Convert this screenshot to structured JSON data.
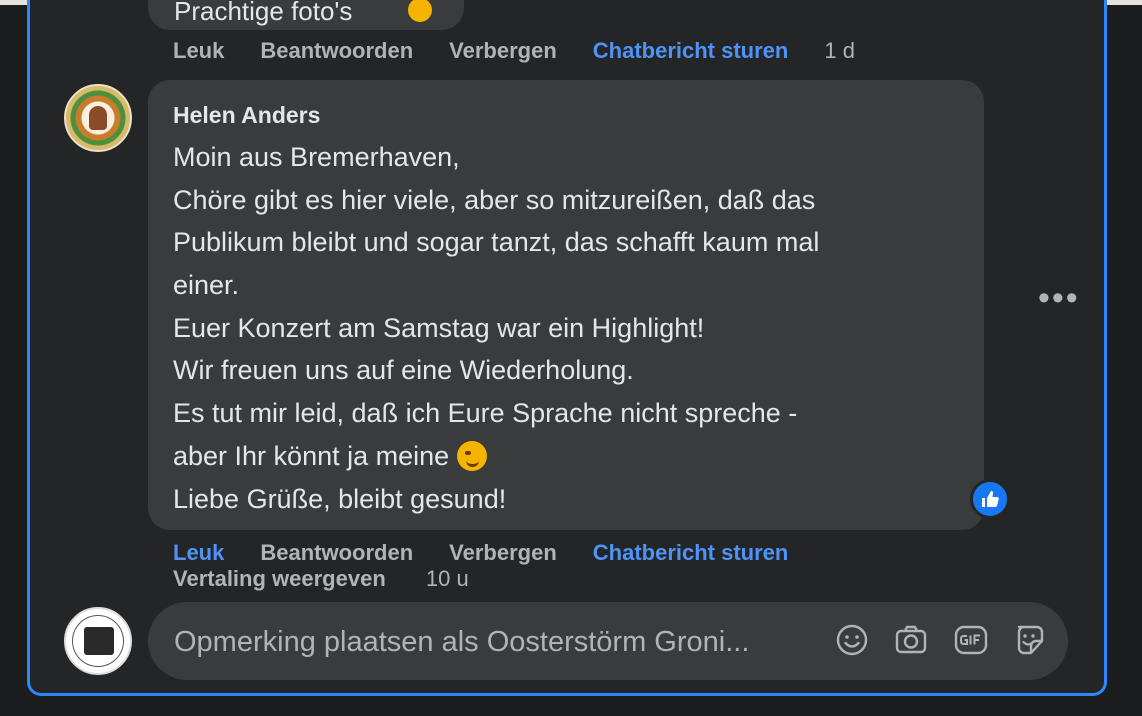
{
  "previous_comment": {
    "text_fragment": "Prachtige foto's",
    "actions": {
      "like": "Leuk",
      "reply": "Beantwoorden",
      "hide": "Verbergen",
      "message": "Chatbericht sturen",
      "time": "1 d"
    }
  },
  "comment": {
    "author": "Helen Anders",
    "lines": [
      "Moin aus Bremerhaven,",
      "Chöre gibt es hier viele, aber so mitzureißen, daß das",
      "Publikum bleibt und sogar tanzt, das schafft kaum mal",
      "einer.",
      "Euer Konzert am Samstag war ein Highlight!",
      "Wir freuen uns auf eine Wiederholung.",
      "Es tut mir leid, daß ich Eure Sprache nicht spreche -",
      "aber Ihr könnt ja meine",
      "Liebe Grüße, bleibt gesund!"
    ],
    "reaction_icon": "thumbs-up-icon",
    "more_icon": "ellipsis-icon",
    "more_label": "•••",
    "actions": {
      "like": "Leuk",
      "reply": "Beantwoorden",
      "hide": "Verbergen",
      "message": "Chatbericht sturen",
      "translate": "Vertaling weergeven",
      "time": "10 u"
    }
  },
  "composer": {
    "placeholder": "Opmerking plaatsen als Oosterstörm Groni...",
    "tools": [
      "emoji-icon",
      "camera-icon",
      "gif-icon",
      "sticker-icon"
    ]
  },
  "colors": {
    "panel": "#242526",
    "bubble": "#3a3b3c",
    "accent": "#2d88ff",
    "link_blue": "#4f93f7",
    "muted": "#b0b3b8"
  }
}
